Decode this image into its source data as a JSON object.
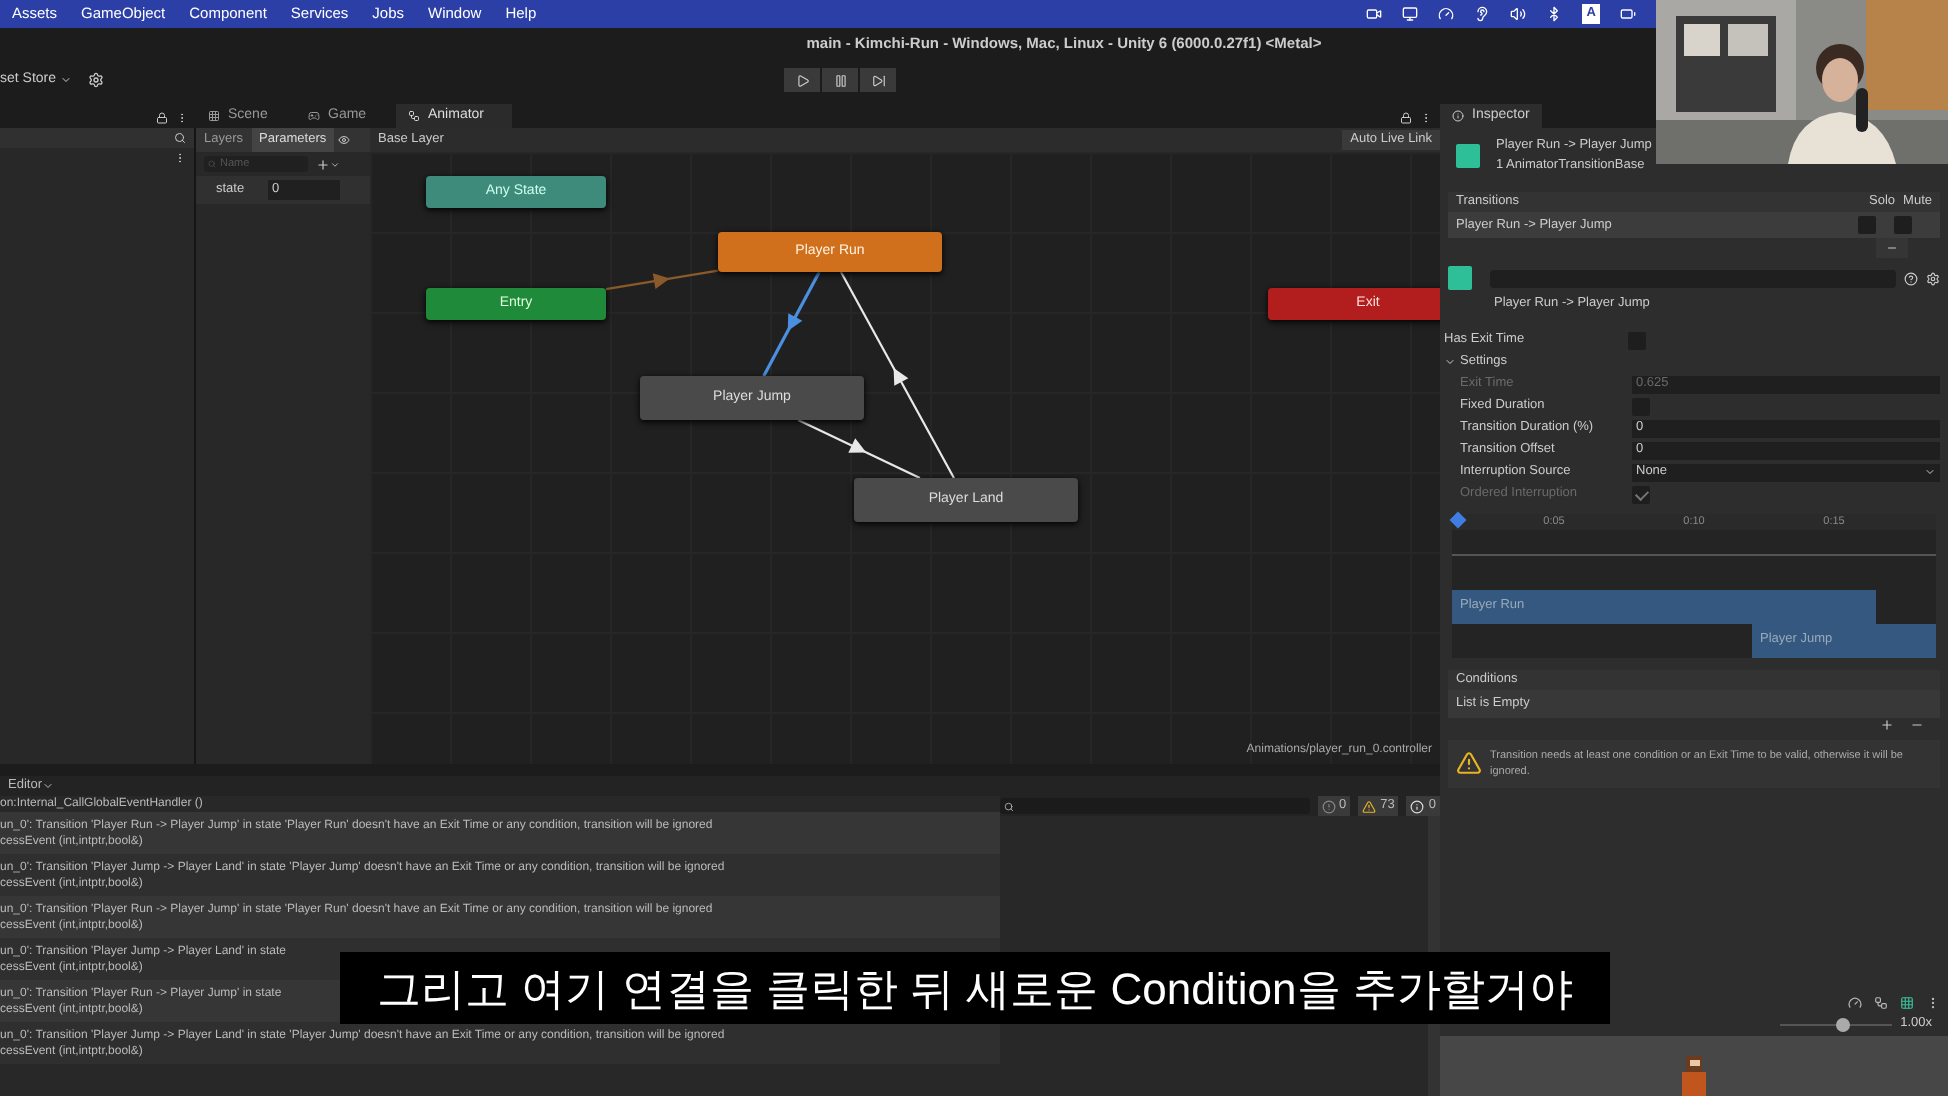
{
  "menu_bar": {
    "items": [
      "Assets",
      "GameObject",
      "Component",
      "Services",
      "Jobs",
      "Window",
      "Help"
    ],
    "input_source": "A"
  },
  "title": "main - Kimchi-Run - Windows, Mac, Linux - Unity 6 (6000.0.27f1) <Metal>",
  "toolbar": {
    "asset_store": "set Store"
  },
  "animator": {
    "tabs": [
      {
        "label": "Scene",
        "selected": false
      },
      {
        "label": "Game",
        "selected": false
      },
      {
        "label": "Animator",
        "selected": true
      }
    ],
    "panel_tabs": [
      {
        "label": "Layers",
        "selected": false
      },
      {
        "label": "Parameters",
        "selected": true
      }
    ],
    "search": {
      "placeholder": "Name"
    },
    "parameters": [
      {
        "name": "state",
        "value": "0"
      }
    ],
    "breadcrumb": "Base Layer",
    "live_link": "Auto Live Link",
    "path": "Animations/player_run_0.controller",
    "states": [
      {
        "name": "Any State",
        "kind": "any"
      },
      {
        "name": "Entry",
        "kind": "entry"
      },
      {
        "name": "Player Run",
        "kind": "default"
      },
      {
        "name": "Player Jump",
        "kind": "normal"
      },
      {
        "name": "Player Land",
        "kind": "normal"
      },
      {
        "name": "Exit",
        "kind": "exit"
      }
    ],
    "transitions": [
      {
        "selected": false
      },
      {
        "selected": true
      },
      {
        "selected": false
      },
      {
        "selected": false
      }
    ]
  },
  "inspector": {
    "tab": "Inspector",
    "title": "Player Run -> Player Jump",
    "subtitle": "1 AnimatorTransitionBase",
    "transitions_header": "Transitions",
    "solo": "Solo",
    "mute": "Mute",
    "transition_rows": [
      {
        "name": "Player Run -> Player Jump",
        "solo": false,
        "mute": false
      }
    ],
    "caption": "Player Run -> Player Jump",
    "has_exit_time": {
      "label": "Has Exit Time",
      "checked": false
    },
    "settings": {
      "label": "Settings",
      "expanded": true,
      "fields": [
        {
          "kind": "text",
          "label": "Exit Time",
          "value": "0.625",
          "disabled": true
        },
        {
          "kind": "checkbox",
          "label": "Fixed Duration",
          "checked": false,
          "disabled": false
        },
        {
          "kind": "text",
          "label": "Transition Duration (%)",
          "value": "0",
          "disabled": false
        },
        {
          "kind": "text",
          "label": "Transition Offset",
          "value": "0",
          "disabled": false
        },
        {
          "kind": "select",
          "label": "Interruption Source",
          "value": "None",
          "disabled": false
        },
        {
          "kind": "checkbox",
          "label": "Ordered Interruption",
          "checked": true,
          "disabled": true
        }
      ]
    },
    "timeline": {
      "ticks": [
        "0:05",
        "0:10",
        "0:15"
      ],
      "bars": [
        {
          "name": "Player Run"
        },
        {
          "name": "Player Jump"
        }
      ]
    },
    "conditions": {
      "label": "Conditions",
      "empty": "List is Empty"
    },
    "warning": "Transition needs at least one condition or an Exit Time to be valid, otherwise it will be ignored.",
    "preview": {
      "speed": "1.00x",
      "level": 0.55
    }
  },
  "console": {
    "mode": "Editor",
    "counts": [
      {
        "kind": "error",
        "count": "0"
      },
      {
        "kind": "warning",
        "count": "73"
      },
      {
        "kind": "info",
        "count": "0"
      }
    ],
    "first_line": "on:Internal_CallGlobalEventHandler ()",
    "entries": [
      {
        "line1": "un_0': Transition 'Player Run -> Player Jump' in state 'Player Run' doesn't have an Exit Time or any condition, transition will be ignored",
        "line2": "cessEvent (int,intptr,bool&)"
      },
      {
        "line1": "un_0': Transition 'Player Jump -> Player Land' in state 'Player Jump' doesn't have an Exit Time or any condition, transition will be ignored",
        "line2": "cessEvent (int,intptr,bool&)"
      },
      {
        "line1": "un_0': Transition 'Player Run -> Player Jump' in state 'Player Run' doesn't have an Exit Time or any condition, transition will be ignored",
        "line2": "cessEvent (int,intptr,bool&)"
      },
      {
        "line1": "un_0': Transition 'Player Jump -> Player Land' in state",
        "line2": "cessEvent (int,intptr,bool&)"
      },
      {
        "line1": "un_0': Transition 'Player Run -> Player Jump' in state",
        "line2": "cessEvent (int,intptr,bool&)"
      },
      {
        "line1": "un_0': Transition 'Player Jump -> Player Land' in state 'Player Jump' doesn't have an Exit Time or any condition, transition will be ignored",
        "line2": "cessEvent (int,intptr,bool&)"
      }
    ]
  },
  "subtitle": "그리고 여기 연결을 클릭한 뒤 새로운 Condition을 추가할거야"
}
